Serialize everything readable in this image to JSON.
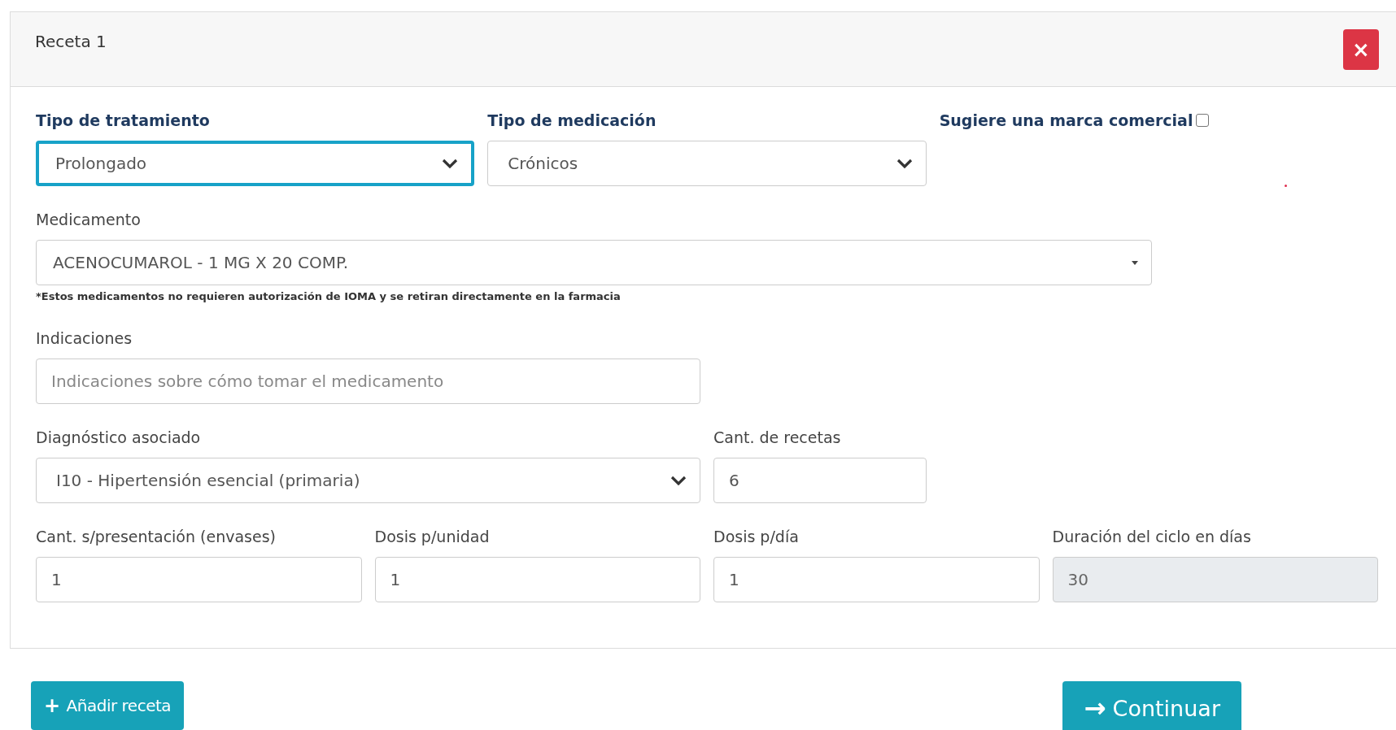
{
  "card": {
    "title": "Receta 1",
    "close_label": "×"
  },
  "fields": [
    {
      "kind": "select",
      "label": "Tipo de tratamiento",
      "value": "Prolongado",
      "focused": true
    },
    {
      "kind": "select",
      "label": "Tipo de medicación",
      "value": "Crónicos",
      "focused": false
    },
    {
      "kind": "checkbox",
      "label": "Sugiere una marca comercial",
      "checked": false
    },
    {
      "kind": "dropdown",
      "label": "Medicamento",
      "value": "ACENOCUMAROL - 1 MG X 20 COMP.",
      "note": "*Estos medicamentos no requieren autorización de IOMA y se retiran directamente en la farmacia"
    },
    {
      "kind": "text",
      "label": "Indicaciones",
      "placeholder": "Indicaciones sobre cómo tomar el medicamento",
      "disabled": false
    },
    {
      "kind": "select",
      "label": "Diagnóstico asociado",
      "value": "I10 - Hipertensión esencial (primaria)",
      "focused": false
    },
    {
      "kind": "text",
      "label": "Cant. de recetas",
      "value": "6",
      "disabled": false
    },
    {
      "kind": "text",
      "label": "Cant. s/presentación (envases)",
      "value": "1",
      "disabled": false
    },
    {
      "kind": "text",
      "label": "Dosis p/unidad",
      "value": "1",
      "disabled": false
    },
    {
      "kind": "text",
      "label": "Dosis p/día",
      "value": "1",
      "disabled": false
    },
    {
      "kind": "text",
      "label": "Duración del ciclo en días",
      "value": "30",
      "disabled": true
    }
  ],
  "buttons": [
    {
      "kind": "add",
      "label": "Añadir receta",
      "icon": "+"
    },
    {
      "kind": "continue",
      "label": "Continuar",
      "icon": "→"
    }
  ]
}
